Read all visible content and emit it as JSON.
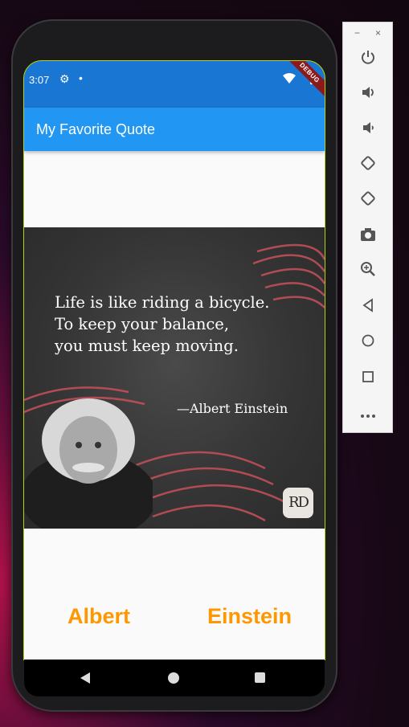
{
  "status_bar": {
    "time": "3:07",
    "debug_ribbon": "DEBUG"
  },
  "app_bar": {
    "title": "My Favorite Quote"
  },
  "quote": {
    "lines": [
      "Life is like riding a bicycle.",
      "To keep your balance,",
      "you must keep moving."
    ],
    "author": "—Albert Einstein",
    "logo_text": "RD"
  },
  "buttons": {
    "left_label": "Albert",
    "right_label": "Einstein"
  },
  "colors": {
    "status_bar": "#1976d2",
    "app_bar": "#2196f3",
    "button_text": "#ff9800",
    "screen_bg": "#fafafa"
  },
  "emulator_toolbar": {
    "window_controls": [
      "minimize-icon",
      "close-icon"
    ],
    "icons": [
      "power-icon",
      "volume-up-icon",
      "volume-down-icon",
      "rotate-left-icon",
      "rotate-right-icon",
      "camera-icon",
      "zoom-icon",
      "back-icon",
      "home-icon",
      "overview-icon",
      "more-icon"
    ]
  }
}
